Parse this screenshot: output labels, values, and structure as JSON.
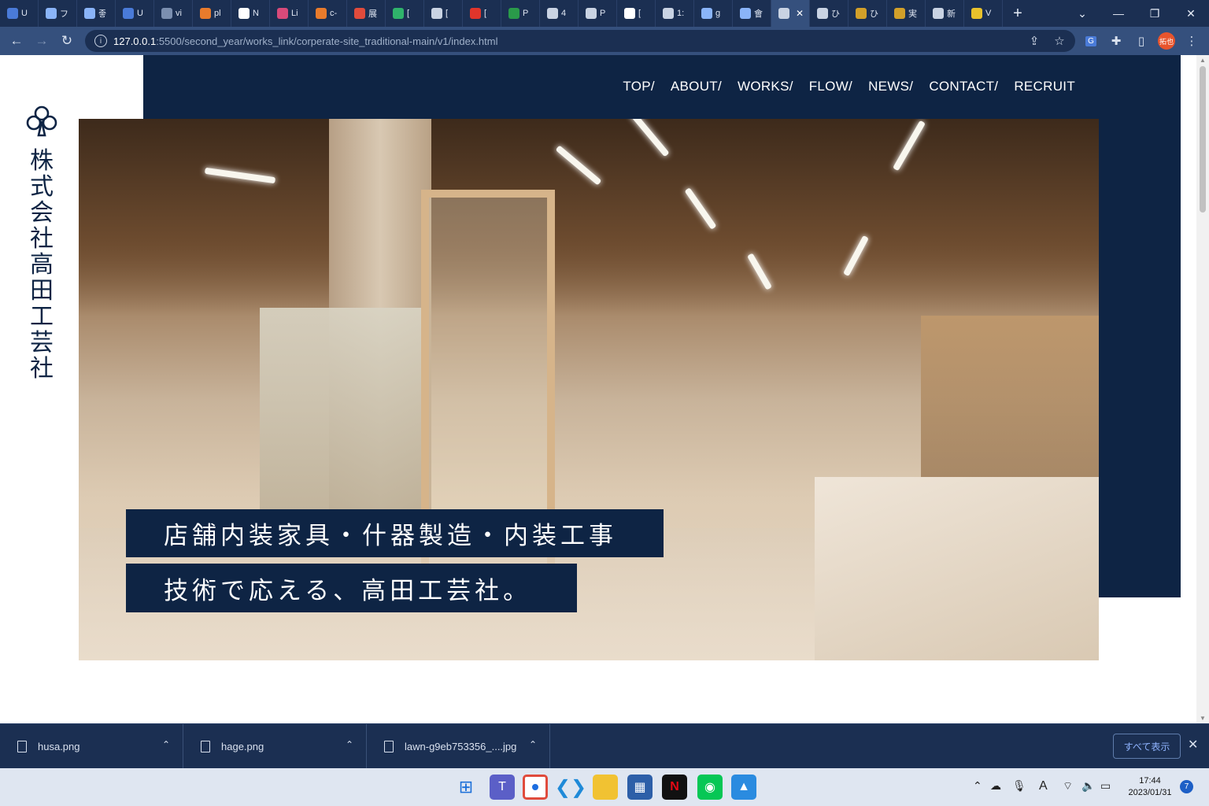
{
  "browser": {
    "tabs": [
      {
        "label": "U",
        "icon": "site-icon",
        "color": "#4a7bd8"
      },
      {
        "label": "フ",
        "icon": "search-icon",
        "color": "#8ab4f8"
      },
      {
        "label": "좋",
        "icon": "search-icon",
        "color": "#8ab4f8"
      },
      {
        "label": "U",
        "icon": "site-icon",
        "color": "#4a7bd8"
      },
      {
        "label": "vi",
        "icon": "site-icon",
        "color": "#7b8fb0"
      },
      {
        "label": "pl",
        "icon": "site-icon",
        "color": "#e87b2c"
      },
      {
        "label": "N",
        "icon": "site-icon",
        "color": "#ffffff"
      },
      {
        "label": "Li",
        "icon": "site-icon",
        "color": "#d84a7a"
      },
      {
        "label": "c-",
        "icon": "site-icon",
        "color": "#e87b2c"
      },
      {
        "label": "展",
        "icon": "calendar-icon",
        "color": "#e04b3c"
      },
      {
        "label": "[",
        "icon": "site-icon",
        "color": "#2fb36b"
      },
      {
        "label": "[",
        "icon": "globe-icon",
        "color": "#c9d3e3"
      },
      {
        "label": "[",
        "icon": "site-icon",
        "color": "#e0352b"
      },
      {
        "label": "P",
        "icon": "site-icon",
        "color": "#2a9a4a"
      },
      {
        "label": "4",
        "icon": "globe-icon",
        "color": "#c9d3e3"
      },
      {
        "label": "P",
        "icon": "wordpress-icon",
        "color": "#c9d3e3"
      },
      {
        "label": "[",
        "icon": "site-icon",
        "color": "#ffffff"
      },
      {
        "label": "1:",
        "icon": "globe-icon",
        "color": "#c9d3e3"
      },
      {
        "label": "g",
        "icon": "search-icon",
        "color": "#8ab4f8"
      },
      {
        "label": "會",
        "icon": "search-icon",
        "color": "#8ab4f8"
      },
      {
        "label": "",
        "icon": "globe-icon",
        "color": "#c9d3e3",
        "active": true
      },
      {
        "label": "ひ",
        "icon": "site-icon",
        "color": "#c9d3e3"
      },
      {
        "label": "ひ",
        "icon": "site-icon",
        "color": "#d2a02a"
      },
      {
        "label": "実",
        "icon": "site-icon",
        "color": "#d2a02a"
      },
      {
        "label": "新",
        "icon": "globe-icon",
        "color": "#c9d3e3"
      },
      {
        "label": "V",
        "icon": "star-icon",
        "color": "#e8c12c"
      }
    ],
    "new_tab_symbol": "+",
    "window_controls": {
      "minimize": "—",
      "maximize": "❐",
      "close": "✕",
      "dropdown": "⌄"
    },
    "url": {
      "host": "127.0.0.1",
      "path": ":5500/second_year/works_link/corperate-site_traditional-main/v1/index.html"
    },
    "profile_label": "拓也"
  },
  "site": {
    "nav": [
      "TOP/",
      "ABOUT/",
      "WORKS/",
      "FLOW/",
      "NEWS/",
      "CONTACT/",
      "RECRUIT"
    ],
    "company_name_chars": [
      "株",
      "式",
      "会",
      "社",
      "高",
      "田",
      "工",
      "芸",
      "社"
    ],
    "hero_icon": "workshop-photo",
    "catch_line1": "店舗内装家具・什器製造・内装工事",
    "catch_line2": "技術で応える、高田工芸社。",
    "brand_color": "#0e2444"
  },
  "downloads": {
    "items": [
      "husa.png",
      "hage.png",
      "lawn-g9eb753356_....jpg"
    ],
    "show_all": "すべて表示",
    "close": "✕"
  },
  "taskbar": {
    "time": "17:44",
    "date": "2023/01/31",
    "notifications": "7",
    "ime": "A"
  }
}
